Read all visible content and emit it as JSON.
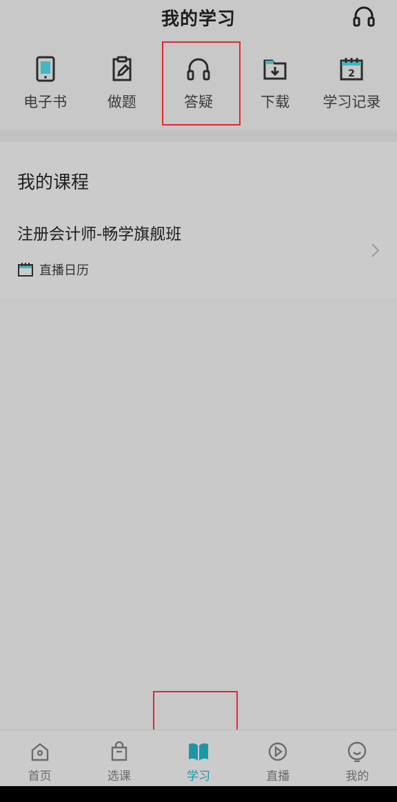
{
  "header": {
    "title": "我的学习",
    "headset_icon": "headset-icon"
  },
  "quick_nav": [
    {
      "label": "电子书",
      "icon": "ebook-icon"
    },
    {
      "label": "做题",
      "icon": "clipboard-edit-icon"
    },
    {
      "label": "答疑",
      "icon": "headphones-icon",
      "highlighted": true
    },
    {
      "label": "下载",
      "icon": "download-folder-icon"
    },
    {
      "label": "学习记录",
      "icon": "calendar-record-icon"
    }
  ],
  "courses": {
    "title": "我的课程",
    "items": [
      {
        "name": "注册会计师-畅学旗舰班",
        "calendar_label": "直播日历"
      }
    ]
  },
  "bottom_nav": [
    {
      "label": "首页",
      "icon": "home-icon",
      "active": false
    },
    {
      "label": "选课",
      "icon": "shopping-bag-icon",
      "active": false
    },
    {
      "label": "学习",
      "icon": "open-book-icon",
      "active": true
    },
    {
      "label": "直播",
      "icon": "play-circle-icon",
      "active": false
    },
    {
      "label": "我的",
      "icon": "smiley-face-icon",
      "active": false
    }
  ],
  "colors": {
    "accent": "#1a97a7",
    "highlight": "#e0282f",
    "background": "#c8c8c8"
  }
}
